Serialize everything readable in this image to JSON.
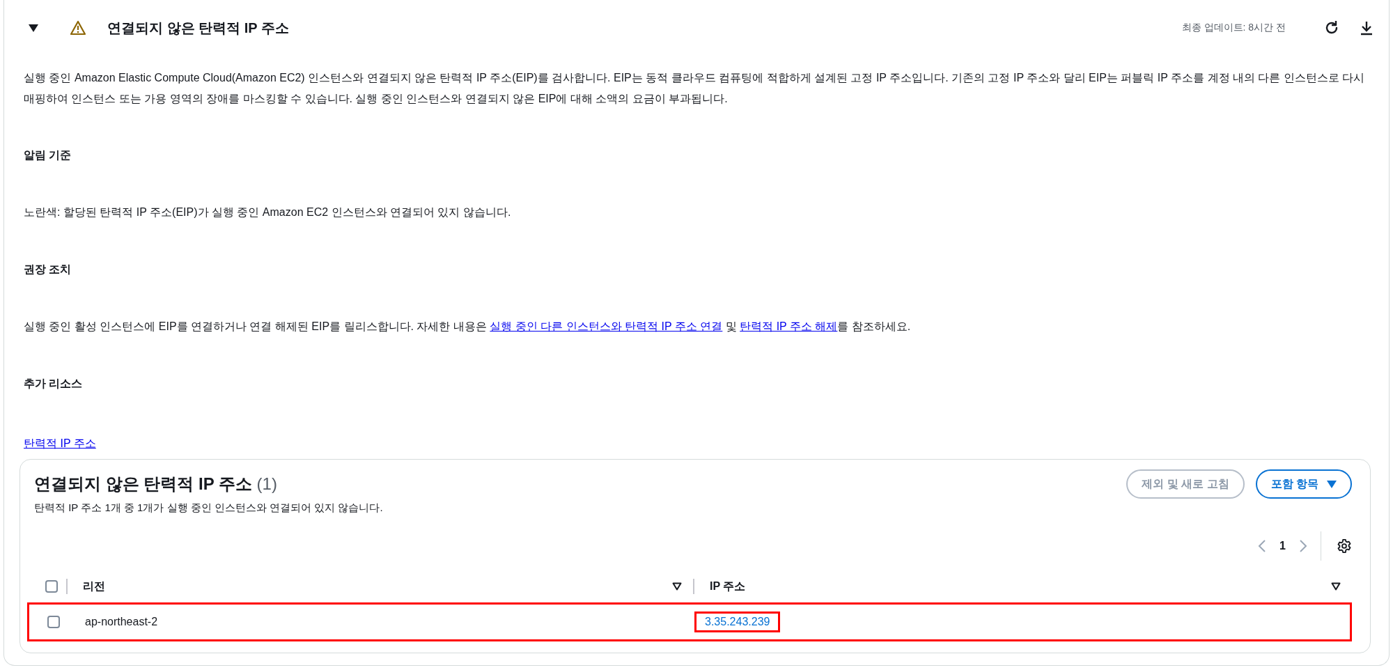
{
  "panel": {
    "expanded": true,
    "title": "연결되지 않은 탄력적 IP 주소",
    "last_updated": "최종 업데이트: 8시간 전"
  },
  "description": "실행 중인 Amazon Elastic Compute Cloud(Amazon EC2) 인스턴스와 연결되지 않은 탄력적 IP 주소(EIP)를 검사합니다. EIP는 동적 클라우드 컴퓨팅에 적합하게 설계된 고정 IP 주소입니다. 기존의 고정 IP 주소와 달리 EIP는 퍼블릭 IP 주소를 계정 내의 다른 인스턴스로 다시 매핑하여 인스턴스 또는 가용 영역의 장애를 마스킹할 수 있습니다. 실행 중인 인스턴스와 연결되지 않은 EIP에 대해 소액의 요금이 부과됩니다.",
  "sections": [
    {
      "heading": "알림 기준",
      "parts": [
        {
          "kind": "text",
          "text": "노란색: 할당된 탄력적 IP 주소(EIP)가 실행 중인 Amazon EC2 인스턴스와 연결되어 있지 않습니다."
        }
      ]
    },
    {
      "heading": "권장 조치",
      "parts": [
        {
          "kind": "text",
          "text": "실행 중인 활성 인스턴스에 EIP를 연결하거나 연결 해제된 EIP를 릴리스합니다. 자세한 내용은 "
        },
        {
          "kind": "link",
          "text": "실행 중인 다른 인스턴스와 탄력적 IP 주소 연결"
        },
        {
          "kind": "text",
          "text": " 및 "
        },
        {
          "kind": "link",
          "text": "탄력적 IP 주소 해제"
        },
        {
          "kind": "text",
          "text": "를 참조하세요."
        }
      ]
    },
    {
      "heading": "추가 리소스"
    }
  ],
  "resource_links": [
    "탄력적 IP 주소"
  ],
  "table": {
    "title": "연결되지 않은 탄력적 IP 주소",
    "count": "(1)",
    "subtitle": "탄력적 IP 주소 1개 중 1개가 실행 중인 인스턴스와 연결되어 있지 않습니다.",
    "buttons": [
      {
        "kind": "plain",
        "label": "제외 및 새로 고침",
        "disabled": true
      },
      {
        "kind": "dropdown",
        "label": "포함 항목",
        "disabled": false
      }
    ],
    "pagination": {
      "page": "1",
      "prev_disabled": true,
      "next_disabled": true
    },
    "header_checked": false,
    "columns": [
      "리전",
      "IP 주소"
    ],
    "rows": [
      {
        "checked": false,
        "highlighted": true,
        "region": "ap-northeast-2",
        "ip": "3.35.243.239",
        "ip_highlighted": true
      }
    ]
  }
}
